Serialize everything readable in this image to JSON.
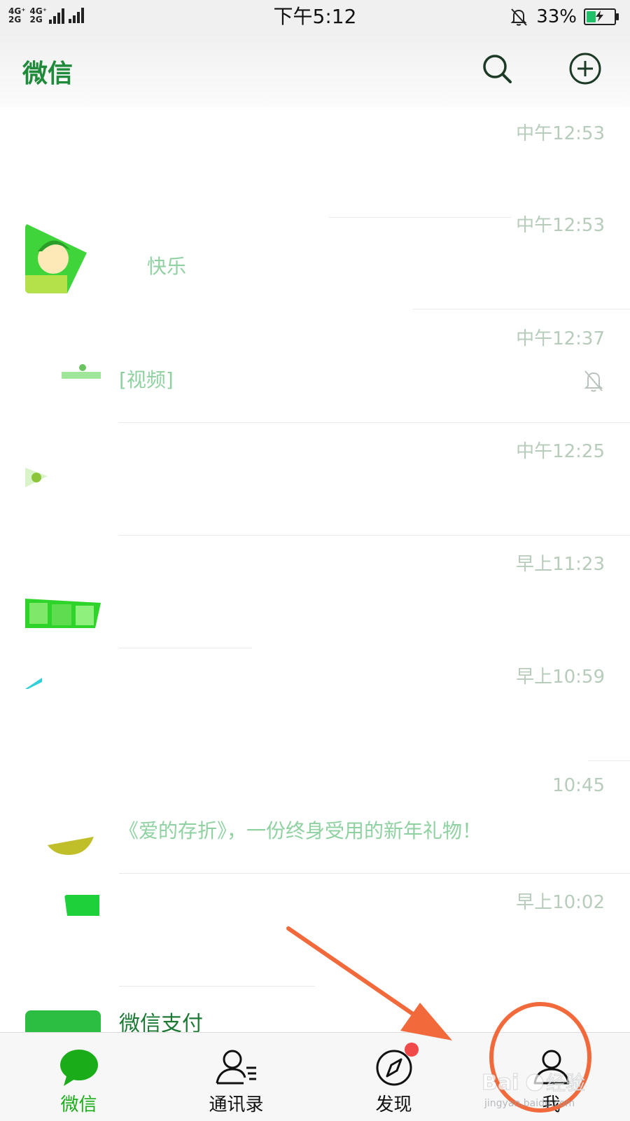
{
  "status_bar": {
    "network_1": "4G⁺",
    "network_2": "4G⁺",
    "network_3": "2G",
    "network_4": "2G",
    "time": "下午5:12",
    "battery": "33%",
    "battery_level": 0.33
  },
  "header": {
    "title": "微信",
    "search_icon": "search-icon",
    "add_icon": "plus-circle-icon"
  },
  "chats": [
    {
      "name": "",
      "time": "中午12:53",
      "preview": ""
    },
    {
      "name": "",
      "time": "中午12:53",
      "preview": "快乐"
    },
    {
      "name": "",
      "time": "中午12:37",
      "preview": "[视频]",
      "muted": true
    },
    {
      "name": "",
      "time": "中午12:25",
      "preview": ""
    },
    {
      "name": "",
      "time": "早上11:23",
      "preview": ""
    },
    {
      "name": "",
      "time": "早上10:59",
      "preview": ""
    },
    {
      "name": "",
      "time": "10:45",
      "preview": "《爱的存折》，一份终身受用的新年礼物！"
    },
    {
      "name": "",
      "time": "早上10:02",
      "preview": ""
    },
    {
      "name": "微信支付",
      "time": "",
      "preview": ""
    }
  ],
  "tabs": [
    {
      "label": "微信",
      "icon": "chat-bubble-icon",
      "active": true
    },
    {
      "label": "通讯录",
      "icon": "contacts-icon"
    },
    {
      "label": "发现",
      "icon": "compass-icon",
      "badge": true
    },
    {
      "label": "我",
      "icon": "person-icon"
    }
  ],
  "colors": {
    "brand_green": "#1aad19",
    "title_green": "#1f8a3a",
    "annotation_orange": "#f26a3c",
    "badge_red": "#f04a4a"
  }
}
